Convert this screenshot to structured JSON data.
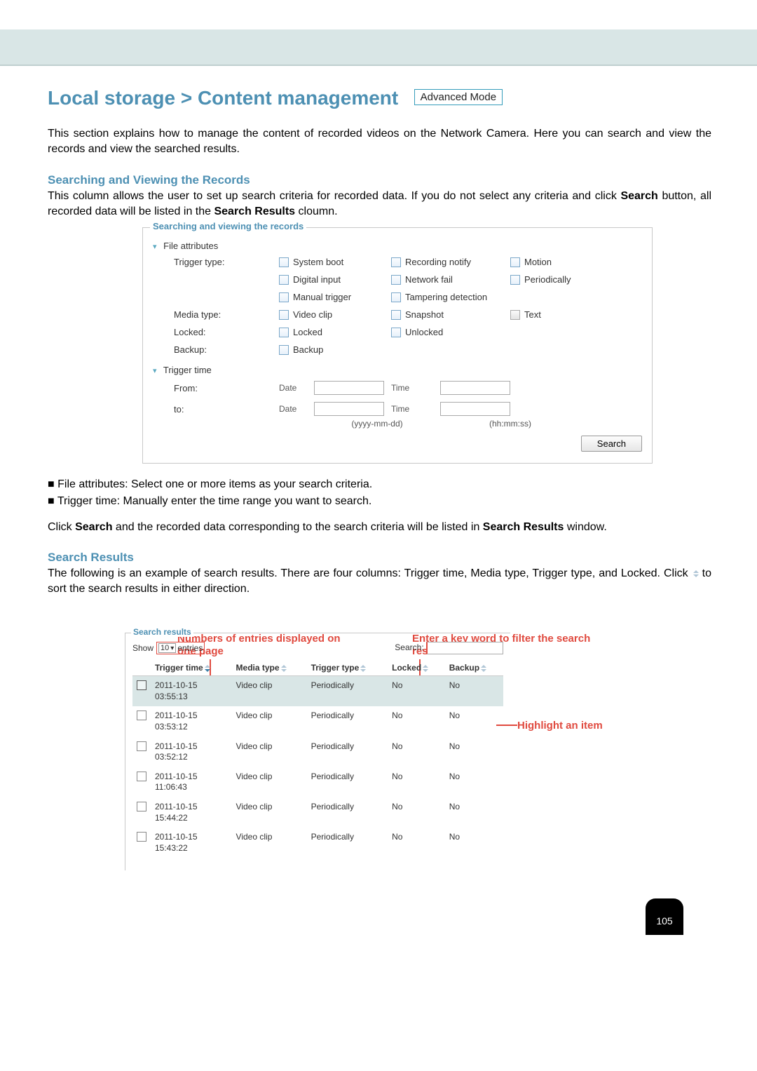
{
  "page": {
    "title": "Local storage > Content management",
    "mode_badge": "Advanced Mode",
    "intro": "This section explains how to manage the content of recorded videos on the Network Camera. Here you can search and view the records and view the searched results."
  },
  "search_section": {
    "title": "Searching and Viewing the Records",
    "desc": "This column allows the user to set up search criteria for recorded data. If you do not select any criteria and click Search button, all recorded data will be listed in the Search Results cloumn.",
    "panel_legend": "Searching and viewing the records",
    "file_attr_label": "File attributes",
    "trigger_time_label": "Trigger time",
    "labels": {
      "trigger_type": "Trigger type:",
      "media_type": "Media type:",
      "locked": "Locked:",
      "backup": "Backup:",
      "from": "From:",
      "to": "to:",
      "date": "Date",
      "time": "Time",
      "date_fmt": "(yyyy-mm-dd)",
      "time_fmt": "(hh:mm:ss)"
    },
    "trigger_types": [
      "System boot",
      "Recording notify",
      "Motion",
      "Digital input",
      "Network fail",
      "Periodically",
      "Manual trigger",
      "Tampering detection"
    ],
    "media_types": [
      "Video clip",
      "Snapshot",
      "Text"
    ],
    "locked_opts": [
      "Locked",
      "Unlocked"
    ],
    "backup_opts": [
      "Backup"
    ],
    "search_btn": "Search"
  },
  "bullets": {
    "b1": "File attributes: Select one or more items as your search criteria.",
    "b2": "Trigger time: Manually enter the time range you want to search."
  },
  "after_search": "Click Search and the recorded data corresponding to the search criteria will be listed in Search Results window.",
  "results_section": {
    "title": "Search Results",
    "desc_prefix": "The following is an example of search results. There are four columns: Trigger time, Media type, Trigger type, and Locked. Click ",
    "desc_suffix": " to sort the search results in either direction."
  },
  "annotations": {
    "left": "Numbers of entries displayed on one page",
    "right": "Enter a key word to filter the search results",
    "highlight": "Highlight an item"
  },
  "results_panel": {
    "legend": "Search results",
    "show": "Show",
    "entries": "entries",
    "entries_value": "10",
    "search_label": "Search:",
    "columns": [
      "Trigger time",
      "Media type",
      "Trigger type",
      "Locked",
      "Backup"
    ]
  },
  "chart_data": {
    "type": "table",
    "title": "Search results",
    "columns": [
      "Trigger time",
      "Media type",
      "Trigger type",
      "Locked",
      "Backup"
    ],
    "rows": [
      {
        "trigger_time": "2011-10-15 03:55:13",
        "media_type": "Video clip",
        "trigger_type": "Periodically",
        "locked": "No",
        "backup": "No",
        "highlight": true
      },
      {
        "trigger_time": "2011-10-15 03:53:12",
        "media_type": "Video clip",
        "trigger_type": "Periodically",
        "locked": "No",
        "backup": "No",
        "highlight": false
      },
      {
        "trigger_time": "2011-10-15 03:52:12",
        "media_type": "Video clip",
        "trigger_type": "Periodically",
        "locked": "No",
        "backup": "No",
        "highlight": false
      },
      {
        "trigger_time": "2011-10-15 11:06:43",
        "media_type": "Video clip",
        "trigger_type": "Periodically",
        "locked": "No",
        "backup": "No",
        "highlight": false
      },
      {
        "trigger_time": "2011-10-15 15:44:22",
        "media_type": "Video clip",
        "trigger_type": "Periodically",
        "locked": "No",
        "backup": "No",
        "highlight": false
      },
      {
        "trigger_time": "2011-10-15 15:43:22",
        "media_type": "Video clip",
        "trigger_type": "Periodically",
        "locked": "No",
        "backup": "No",
        "highlight": false
      }
    ]
  },
  "page_number": "105"
}
